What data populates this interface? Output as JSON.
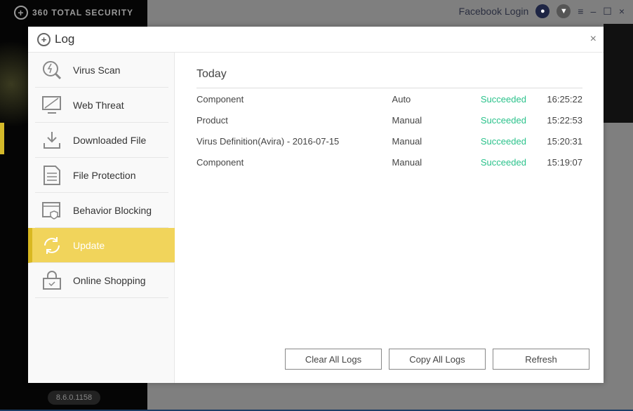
{
  "app": {
    "brand": "360 TOTAL SECURITY",
    "facebook_login": "Facebook Login",
    "version": "8.6.0.1158",
    "minimize": "–",
    "maximize": "☐",
    "close": "×",
    "menu": "≡"
  },
  "dialog": {
    "title": "Log",
    "close": "×"
  },
  "sidebar": {
    "items": [
      {
        "label": "Virus Scan",
        "icon": "virus-scan-icon"
      },
      {
        "label": "Web Threat",
        "icon": "web-threat-icon"
      },
      {
        "label": "Downloaded File",
        "icon": "download-icon"
      },
      {
        "label": "File Protection",
        "icon": "file-protection-icon"
      },
      {
        "label": "Behavior Blocking",
        "icon": "behavior-blocking-icon"
      },
      {
        "label": "Update",
        "icon": "update-icon",
        "active": true
      },
      {
        "label": "Online Shopping",
        "icon": "shopping-icon"
      }
    ]
  },
  "log": {
    "section": "Today",
    "rows": [
      {
        "name": "Component",
        "mode": "Auto",
        "status": "Succeeded",
        "time": "16:25:22"
      },
      {
        "name": "Product",
        "mode": "Manual",
        "status": "Succeeded",
        "time": "15:22:53"
      },
      {
        "name": "Virus Definition(Avira) - 2016-07-15",
        "mode": "Manual",
        "status": "Succeeded",
        "time": "15:20:31"
      },
      {
        "name": "Component",
        "mode": "Manual",
        "status": "Succeeded",
        "time": "15:19:07"
      }
    ]
  },
  "buttons": {
    "clear": "Clear All Logs",
    "copy": "Copy All Logs",
    "refresh": "Refresh"
  },
  "colors": {
    "accent": "#f1d45b",
    "success": "#2bc28b"
  }
}
